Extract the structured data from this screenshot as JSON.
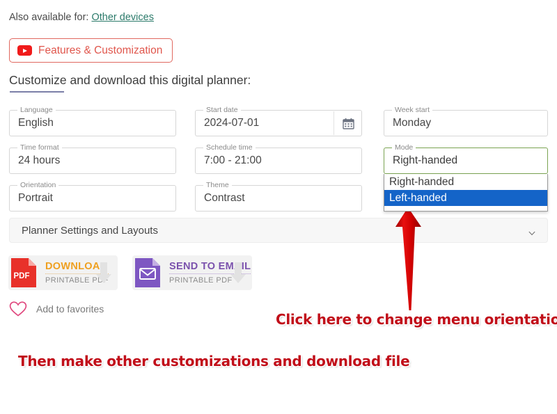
{
  "availability": {
    "prefix": "Also available for:",
    "link_label": "Other devices"
  },
  "features_button": {
    "label": "Features & Customization",
    "icon": "youtube-icon",
    "border_color": "#e0685f",
    "text_color": "#e0564c"
  },
  "heading": "Customize and download this digital planner:",
  "form": {
    "fields": [
      {
        "label": "Language",
        "value": "English",
        "focused": false,
        "has_calendar_icon": false
      },
      {
        "label": "Start date",
        "value": "2024-07-01",
        "focused": false,
        "has_calendar_icon": true
      },
      {
        "label": "Week start",
        "value": "Monday",
        "focused": false,
        "has_calendar_icon": false
      },
      {
        "label": "Time format",
        "value": "24 hours",
        "focused": false,
        "has_calendar_icon": false
      },
      {
        "label": "Schedule time",
        "value": "7:00 - 21:00",
        "focused": false,
        "has_calendar_icon": false
      },
      {
        "label": "Mode",
        "value": "Right-handed",
        "focused": true,
        "has_calendar_icon": false
      },
      {
        "label": "Orientation",
        "value": "Portrait",
        "focused": false,
        "has_calendar_icon": false
      },
      {
        "label": "Theme",
        "value": "Contrast",
        "focused": false,
        "has_calendar_icon": false
      }
    ]
  },
  "mode_dropdown": {
    "open": true,
    "options": [
      "Right-handed",
      "Left-handed"
    ],
    "selected": "Left-handed",
    "highlight_color": "#1464c8",
    "focus_border_color": "#7aa352"
  },
  "accordion": {
    "label": "Planner Settings and Layouts",
    "icon": "chevron-down-icon",
    "expanded": false
  },
  "actions": [
    {
      "title": "DOWNLOAD",
      "subtitle": "PRINTABLE PDF",
      "icon": "pdf-file-icon",
      "icon_color": "#e8312a",
      "title_color": "#efa020"
    },
    {
      "title": "SEND TO EMAIL",
      "subtitle": "PRINTABLE PDF",
      "icon": "envelope-file-icon",
      "icon_color": "#7e57c2",
      "title_color": "#7b52ad"
    }
  ],
  "favorites": {
    "label": "Add to favorites",
    "icon": "heart-outline-icon",
    "icon_color": "#e0497f"
  },
  "annotations": {
    "arrow": "red-up-arrow",
    "arrow_color": "#cc0000",
    "text_color": "#c10f1a",
    "line_1": "Click here to change menu orientation",
    "line_2": "Then make other customizations and download file"
  }
}
